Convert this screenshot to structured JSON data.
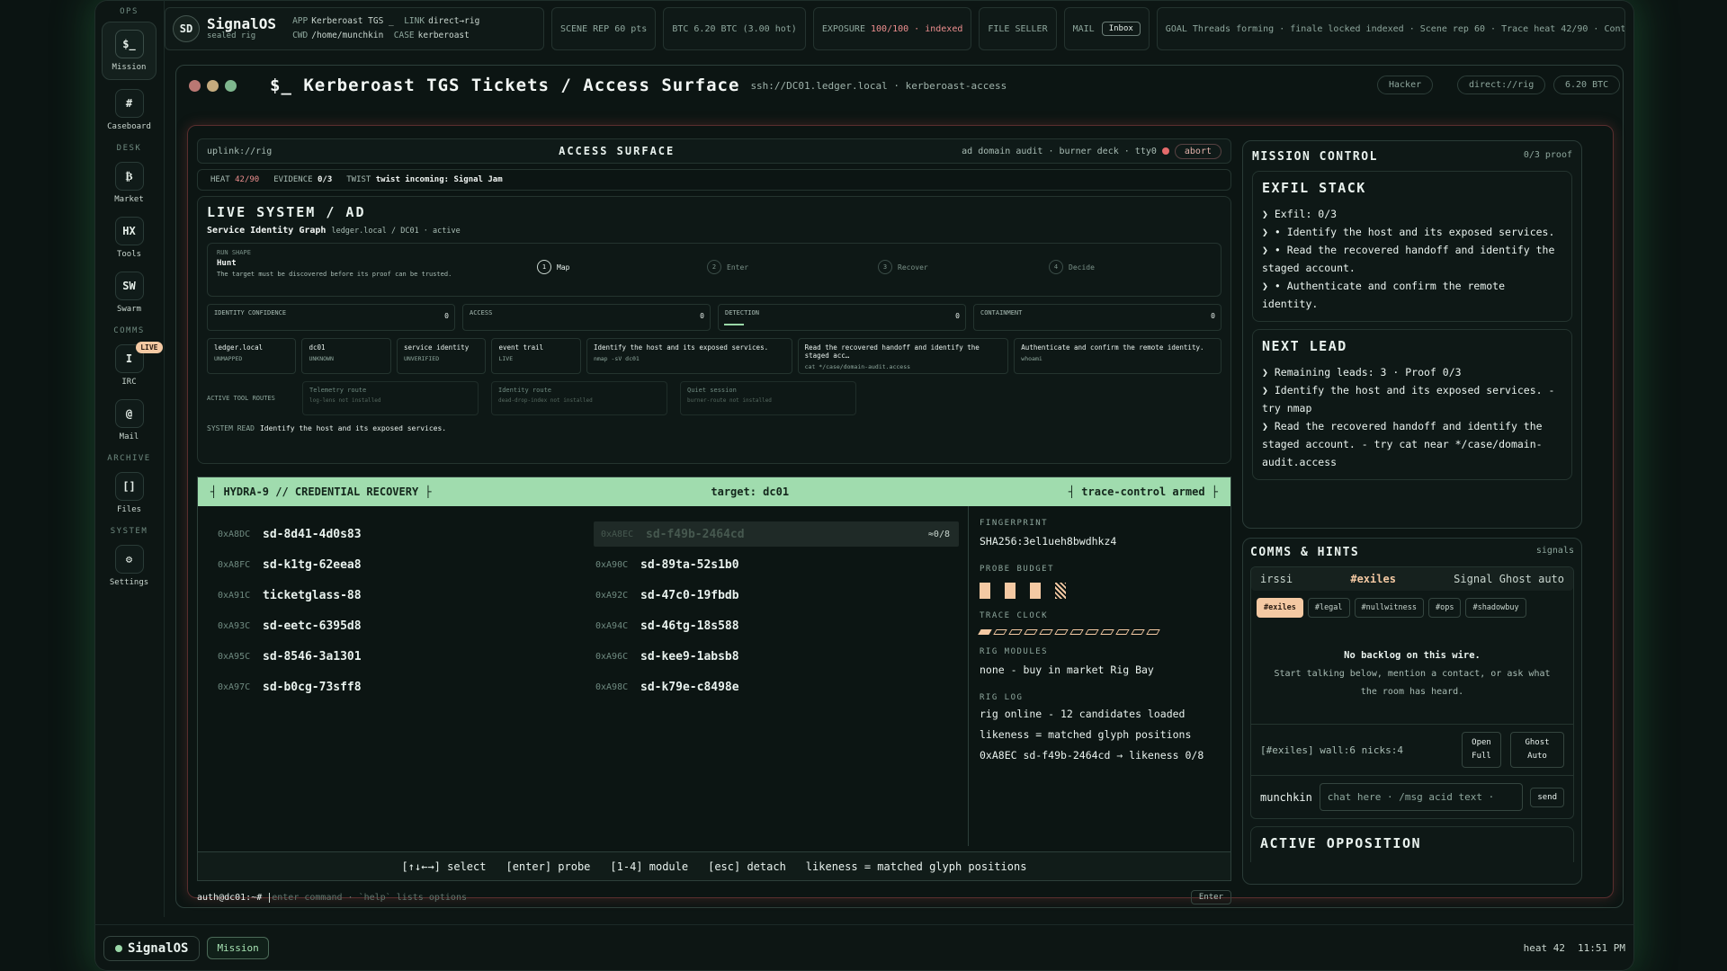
{
  "sidebar": {
    "groups": {
      "ops": "OPS",
      "desk": "DESK",
      "comms": "COMMS",
      "archive": "ARCHIVE",
      "system": "SYSTEM"
    },
    "items": [
      {
        "glyph": "$_",
        "label": "Mission"
      },
      {
        "glyph": "#",
        "label": "Caseboard"
      },
      {
        "glyph": "₿",
        "label": "Market"
      },
      {
        "glyph": "HX",
        "label": "Tools"
      },
      {
        "glyph": "SW",
        "label": "Swarm"
      },
      {
        "glyph": "I",
        "label": "IRC",
        "badge": "LIVE"
      },
      {
        "glyph": "@",
        "label": "Mail"
      },
      {
        "glyph": "[]",
        "label": "Files"
      },
      {
        "glyph": "⚙",
        "label": "Settings"
      }
    ]
  },
  "topbar": {
    "avatar": "SD",
    "title": "SignalOS",
    "subtitle": "sealed rig",
    "app_label": "APP",
    "app": "Kerberoast TGS _",
    "link_label": "LINK",
    "link": "direct→rig",
    "cwd_label": "CWD",
    "cwd": "/home/munchkin",
    "case_label": "CASE",
    "case": "kerberoast",
    "scene": "SCENE REP 60 pts",
    "btc": "BTC 6.20 BTC (3.00 hot)",
    "exposure_label": "EXPOSURE",
    "exposure": "100/100 · indexed",
    "file": "FILE SELLER",
    "mail": "MAIL",
    "inbox": "Inbox",
    "goal": "GOAL Threads forming · finale locked indexed · Scene rep 60 · Trace heat 42/90 · Contract"
  },
  "window": {
    "title": "$_ Kerberoast TGS Tickets / Access Surface",
    "path": "ssh://DC01.ledger.local · kerberoast-access",
    "pills": [
      "Hacker",
      "direct://rig",
      "6.20 BTC"
    ]
  },
  "surface": {
    "uplink": "uplink://rig",
    "title": "ACCESS SURFACE",
    "meta": "ad domain audit · burner deck · tty0",
    "abort": "abort",
    "heat_label": "HEAT",
    "heat": "42/90",
    "evidence_label": "EVIDENCE",
    "evidence": "0/3",
    "twist_label": "TWIST",
    "twist": "twist incoming: Signal Jam"
  },
  "live": {
    "title": "LIVE SYSTEM / AD",
    "graph_title": "Service Identity Graph",
    "graph_sub": "ledger.local / DC01 · active",
    "run_shape_label": "RUN SHAPE",
    "run_shape": "Hunt",
    "run_desc": "The target must be discovered before its proof can be trusted.",
    "steps": [
      {
        "n": "1",
        "label": "Map"
      },
      {
        "n": "2",
        "label": "Enter"
      },
      {
        "n": "3",
        "label": "Recover"
      },
      {
        "n": "4",
        "label": "Decide"
      }
    ],
    "meters": [
      {
        "label": "IDENTITY CONFIDENCE",
        "value": "0"
      },
      {
        "label": "ACCESS",
        "value": "0"
      },
      {
        "label": "DETECTION",
        "value": "0"
      },
      {
        "label": "CONTAINMENT",
        "value": "0"
      }
    ],
    "cards": [
      {
        "t": "ledger.local",
        "s": "UNMAPPED"
      },
      {
        "t": "dc01",
        "s": "UNKNOWN"
      },
      {
        "t": "service identity",
        "s": "UNVERIFIED"
      },
      {
        "t": "event trail",
        "s": "LIVE"
      },
      {
        "t": "Identify the host and its exposed services.",
        "s": "nmap -sV dc01"
      },
      {
        "t": "Read the recovered handoff and identify the staged acc…",
        "s": "cat */case/domain-audit.access"
      },
      {
        "t": "Authenticate and confirm the remote identity.",
        "s": "whoami"
      }
    ],
    "routes_label": "ACTIVE TOOL ROUTES",
    "routes": [
      {
        "t": "Telemetry route",
        "s": "log-lens not installed"
      },
      {
        "t": "Identity route",
        "s": "dead-drop-index not installed"
      },
      {
        "t": "Quiet session",
        "s": "burner-route not installed"
      }
    ],
    "sysread_label": "SYSTEM READ",
    "sysread": "Identify the host and its exposed services."
  },
  "hydra": {
    "left": "┤ HYDRA-9 // CREDENTIAL RECOVERY ├",
    "target": "target: dc01",
    "right": "┤ trace-control armed ├",
    "rows": [
      [
        {
          "a": "0xA8DC",
          "n": "sd-8d41-4d0s83"
        },
        {
          "a": "0xA8EC",
          "n": "sd-f49b-2464cd",
          "t": "≈0/8",
          "sel": true
        }
      ],
      [
        {
          "a": "0xA8FC",
          "n": "sd-k1tg-62eea8"
        },
        {
          "a": "0xA90C",
          "n": "sd-89ta-52s1b0"
        }
      ],
      [
        {
          "a": "0xA91C",
          "n": "ticketglass-88"
        },
        {
          "a": "0xA92C",
          "n": "sd-47c0-19fbdb"
        }
      ],
      [
        {
          "a": "0xA93C",
          "n": "sd-eetc-6395d8"
        },
        {
          "a": "0xA94C",
          "n": "sd-46tg-18s588"
        }
      ],
      [
        {
          "a": "0xA95C",
          "n": "sd-8546-3a1301"
        },
        {
          "a": "0xA96C",
          "n": "sd-kee9-1absb8"
        }
      ],
      [
        {
          "a": "0xA97C",
          "n": "sd-b0cg-73sff8"
        },
        {
          "a": "0xA98C",
          "n": "sd-k79e-c8498e"
        }
      ]
    ],
    "fingerprint_label": "FINGERPRINT",
    "fingerprint": "SHA256:3el1ueh8bwdhkz4",
    "budget_label": "PROBE BUDGET",
    "budget": {
      "used": 3,
      "total": 4
    },
    "clock_label": "TRACE CLOCK",
    "clock": {
      "filled": 1,
      "total": 12
    },
    "modules_label": "RIG MODULES",
    "modules": "none - buy in market Rig Bay",
    "log_label": "RIG LOG",
    "log": [
      "rig online - 12 candidates loaded",
      "likeness = matched glyph positions",
      "0xA8EC sd-f49b-2464cd → likeness 0/8"
    ],
    "footer": [
      "[↑↓←→] select",
      "[enter] probe",
      "[1-4] module",
      "[esc] detach",
      "likeness = matched glyph positions"
    ]
  },
  "cmd": {
    "prompt": "auth@dc01:~#",
    "placeholder": "enter command · `help` lists options",
    "enter": "Enter"
  },
  "mission": {
    "title": "MISSION CONTROL",
    "proof": "0/3 proof",
    "exfil_title": "EXFIL STACK",
    "exfil": [
      "❯ Exfil: 0/3",
      "❯ • Identify the host and its exposed services.",
      "❯ • Read the recovered handoff and identify the staged account.",
      "❯ • Authenticate and confirm the remote identity."
    ],
    "lead_title": "NEXT LEAD",
    "lead": [
      "❯ Remaining leads: 3 · Proof 0/3",
      "❯ Identify the host and its exposed services. - try nmap",
      "❯ Read the recovered handoff and identify the staged account. - try cat near */case/domain-audit.access"
    ]
  },
  "comms": {
    "title": "COMMS & HINTS",
    "right": "signals",
    "client": "irssi",
    "channel": "#exiles",
    "mode": "Signal Ghost auto",
    "chips": [
      "#exiles",
      "#legal",
      "#nullwitness",
      "#ops",
      "#shadowbuy"
    ],
    "backlog_title": "No backlog on this wire.",
    "backlog_text": "Start talking below, mention a contact, or ask what the room has heard.",
    "wall": "[#exiles] wall:6 nicks:4",
    "open": "Open Full",
    "ghost": "Ghost Auto",
    "nick": "munchkin",
    "chat_placeholder": "chat here · /msg acid text ·",
    "send": "send",
    "opposition": "ACTIVE OPPOSITION"
  },
  "bottom": {
    "brand": "SignalOS",
    "tab": "Mission",
    "heat": "heat 42",
    "time": "11:51 PM"
  }
}
